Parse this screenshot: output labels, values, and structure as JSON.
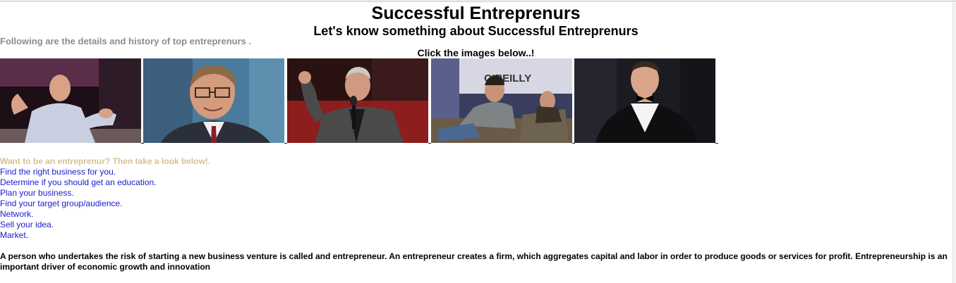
{
  "page": {
    "title": "Successful Entreprenurs",
    "subtitle": "Let's know something about Successful Entreprenurs",
    "intro": "Following are the details and history of top entreprenurs .",
    "click_hint": "Click the images below..!"
  },
  "gallery": {
    "images": [
      {
        "name": "entrepreneur-photo-1"
      },
      {
        "name": "entrepreneur-photo-2"
      },
      {
        "name": "entrepreneur-photo-3"
      },
      {
        "name": "entrepreneur-photo-4",
        "sign_text": "O'REILLY"
      },
      {
        "name": "entrepreneur-photo-5"
      }
    ]
  },
  "guide": {
    "heading": "Want to be an entreprenur? Then take a look below!.",
    "steps": [
      "Find the right business for you.",
      "Determine if you should get an education.",
      "Plan your business.",
      "Find your target group/audience.",
      "Network.",
      "Sell your idea.",
      "Market."
    ]
  },
  "definition": "A person who undertakes the risk of starting a new business venture is called and entrepreneur. An entrepreneur creates a firm, which aggregates capital and labor in order to produce goods or services for profit. Entrepreneurship is an important driver of economic growth and innovation",
  "colors": {
    "intro_text": "#8c8c8c",
    "want_heading": "#d9c08e",
    "step_link": "#1a1ad0"
  }
}
